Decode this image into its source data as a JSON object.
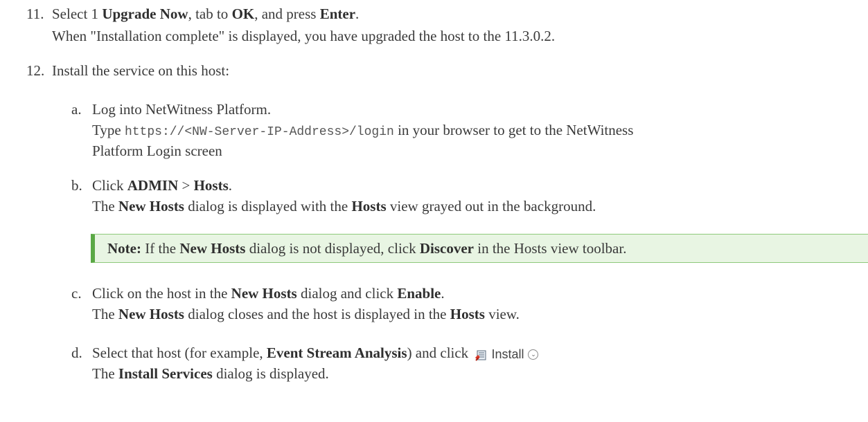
{
  "steps": [
    {
      "num": "11.",
      "text_parts": [
        "Select 1 ",
        "Upgrade Now",
        ", tab to ",
        "OK",
        ", and press ",
        "Enter",
        "."
      ],
      "sub": "When \"Installation complete\" is displayed, you have upgraded the host to the 11.3.0.2."
    },
    {
      "num": "12.",
      "text": "Install the service on this host:"
    }
  ],
  "substeps": {
    "a": {
      "label": "a.",
      "title": "Log into NetWitness Platform.",
      "type_prefix": "Type ",
      "url": "https://<NW-Server-IP-Address>/login",
      "type_suffix": " in your browser to get to the NetWitness",
      "type_cont": "Platform Login screen"
    },
    "b": {
      "label": "b.",
      "p1": "Click ",
      "admin": "ADMIN",
      "sep": " > ",
      "hosts": "Hosts",
      "end": ".",
      "l2_1": "The ",
      "l2_newhosts": "New Hosts",
      "l2_2": " dialog is displayed with the ",
      "l2_hosts": "Hosts",
      "l2_3": " view grayed out in the background."
    },
    "note": {
      "label": "Note:",
      "t1": " If the ",
      "newhosts": "New Hosts",
      "t2": " dialog is not displayed, click ",
      "discover": "Discover",
      "t3": " in the Hosts view toolbar."
    },
    "c": {
      "label": "c.",
      "p1": "Click on the host in the ",
      "newhosts": "New Hosts",
      "p2": " dialog and click ",
      "enable": "Enable",
      "p3": ".",
      "l2_1": "The ",
      "l2_newhosts": "New Hosts",
      "l2_2": " dialog closes and the host is displayed in the ",
      "l2_hosts": "Hosts",
      "l2_3": " view."
    },
    "d": {
      "label": "d.",
      "p1": "Select that host (for example, ",
      "esa": "Event Stream Analysis",
      "p2": ") and click ",
      "install_label": "Install",
      "install_icon": "install-services-icon",
      "l2_1": "The ",
      "l2_dialog": "Install Services",
      "l2_2": " dialog is displayed."
    }
  },
  "colors": {
    "note_bg": "#e8f5e3",
    "note_border": "#5aa845"
  }
}
